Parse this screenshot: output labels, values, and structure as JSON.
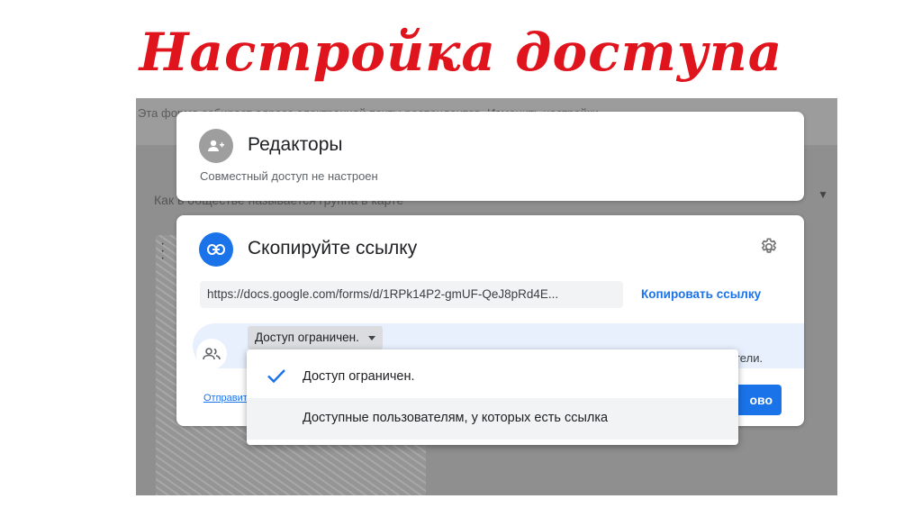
{
  "slide": {
    "title": "Настройка доступа"
  },
  "background": {
    "form_text": "Эта форма собирает адреса электронной почты респондентов. Изменить настройки",
    "question_text": "Как в обществе называется группа в карте"
  },
  "editors_card": {
    "icon": "add-person-icon",
    "heading": "Редакторы",
    "subtitle": "Совместный доступ не настроен"
  },
  "link_card": {
    "icon": "link-icon",
    "heading": "Скопируйте ссылку",
    "settings_icon": "gear-icon",
    "url": "https://docs.google.com/forms/d/1RPk14P2-gmUF-QeJ8pRd4E...",
    "copy_label": "Копировать ссылку",
    "access_icon": "people-icon",
    "access_value": "Доступ ограничен.",
    "access_desc_tail": "тели.",
    "send_label": "Отправит",
    "done_label": "ово"
  },
  "dropdown": {
    "options": [
      {
        "label": "Доступ ограничен.",
        "selected": true
      },
      {
        "label": "Доступные пользователям, у которых есть ссылка",
        "selected": false
      }
    ]
  },
  "colors": {
    "title": "#e0141c",
    "accent": "#1a73e8",
    "shadow_bg": "#8f8f8f"
  }
}
